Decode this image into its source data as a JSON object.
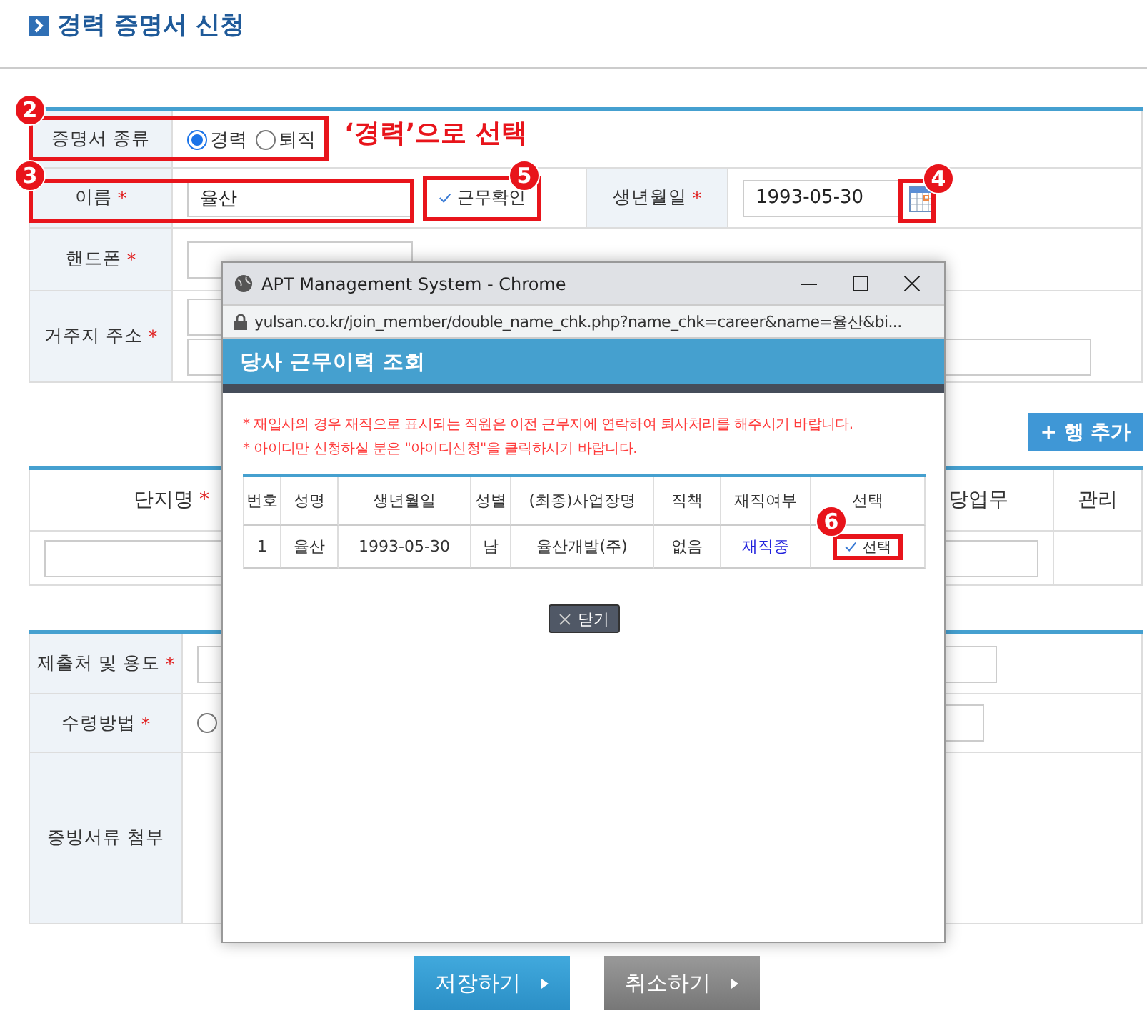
{
  "page_title": "경력 증명서 신청",
  "certificate_type": {
    "label": "증명서 종류",
    "marker": "2",
    "options": [
      {
        "label": "경력",
        "selected": true
      },
      {
        "label": "퇴직",
        "selected": false
      }
    ]
  },
  "annotation_note": "‘경력’으로 선택",
  "name": {
    "label": "이름",
    "required_mark": "*",
    "value": "율산",
    "marker": "3",
    "check_button": {
      "label": "근무확인",
      "marker": "5"
    }
  },
  "birth_date": {
    "label": "생년월일",
    "required_mark": "*",
    "value": "1993-05-30",
    "marker": "4"
  },
  "phone": {
    "label": "핸드폰",
    "required_mark": "*"
  },
  "address": {
    "label": "거주지 주소",
    "required_mark": "*"
  },
  "add_row_button": "+ 행 추가",
  "complex_table": {
    "columns": [
      {
        "label": "단지명",
        "required_mark": "*"
      },
      {
        "label": "당업무"
      },
      {
        "label": "관리"
      }
    ]
  },
  "submission": {
    "label": "제출처 및 용도",
    "required_mark": "*"
  },
  "receipt_method": {
    "label": "수령방법",
    "required_mark": "*",
    "options": [
      {
        "selected": false
      }
    ]
  },
  "attachments": {
    "label": "증빙서류 첨부"
  },
  "buttons": [
    {
      "label": "저장하기",
      "kind": "primary"
    },
    {
      "label": "취소하기",
      "kind": "secondary"
    }
  ],
  "popup": {
    "window_title": "APT Management System - Chrome",
    "url": "yulsan.co.kr/join_member/double_name_chk.php?name_chk=career&name=율산&bi...",
    "heading": "당사 근무이력 조회",
    "notices": [
      "* 재입사의 경우 재직으로 표시되는 직원은 이전 근무지에 연락하여 퇴사처리를 해주시기 바랍니다.",
      "* 아이디만 신청하실 분은 \"아이디신청\"을 클릭하시기 바랍니다."
    ],
    "columns": [
      "번호",
      "성명",
      "생년월일",
      "성별",
      "(최종)사업장명",
      "직책",
      "재직여부",
      "선택"
    ],
    "rows": [
      {
        "cells": [
          "1",
          "율산",
          "1993-05-30",
          "남",
          "율산개발(주)",
          "없음"
        ],
        "status": "재직중",
        "action": "선택",
        "marker": "6"
      }
    ],
    "close_button": "닫기"
  }
}
